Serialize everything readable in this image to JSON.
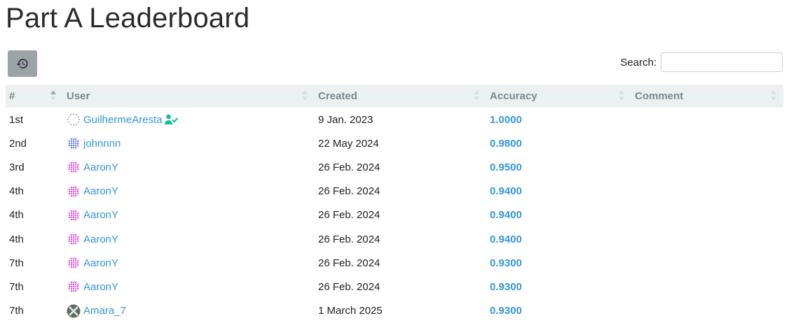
{
  "page_title": "Part A Leaderboard",
  "search": {
    "label": "Search:",
    "value": "",
    "placeholder": ""
  },
  "history_button": {
    "icon": "history-icon"
  },
  "table": {
    "columns": [
      "#",
      "User",
      "Created",
      "Accuracy",
      "Comment"
    ],
    "sort": {
      "column": "#",
      "direction": "asc"
    },
    "rows": [
      {
        "rank": "1st",
        "user": "GuilhermeAresta",
        "avatar": "avatar-dots-grey",
        "verified": true,
        "created": "9 Jan. 2023",
        "accuracy": "1.0000",
        "comment": ""
      },
      {
        "rank": "2nd",
        "user": "johnnnn",
        "avatar": "avatar-grid-blue",
        "verified": false,
        "created": "22 May 2024",
        "accuracy": "0.9800",
        "comment": ""
      },
      {
        "rank": "3rd",
        "user": "AaronY",
        "avatar": "avatar-grid-pink",
        "verified": false,
        "created": "26 Feb. 2024",
        "accuracy": "0.9500",
        "comment": ""
      },
      {
        "rank": "4th",
        "user": "AaronY",
        "avatar": "avatar-grid-pink",
        "verified": false,
        "created": "26 Feb. 2024",
        "accuracy": "0.9400",
        "comment": ""
      },
      {
        "rank": "4th",
        "user": "AaronY",
        "avatar": "avatar-grid-pink",
        "verified": false,
        "created": "26 Feb. 2024",
        "accuracy": "0.9400",
        "comment": ""
      },
      {
        "rank": "4th",
        "user": "AaronY",
        "avatar": "avatar-grid-pink",
        "verified": false,
        "created": "26 Feb. 2024",
        "accuracy": "0.9400",
        "comment": ""
      },
      {
        "rank": "7th",
        "user": "AaronY",
        "avatar": "avatar-grid-pink",
        "verified": false,
        "created": "26 Feb. 2024",
        "accuracy": "0.9300",
        "comment": ""
      },
      {
        "rank": "7th",
        "user": "AaronY",
        "avatar": "avatar-grid-pink",
        "verified": false,
        "created": "26 Feb. 2024",
        "accuracy": "0.9300",
        "comment": ""
      },
      {
        "rank": "7th",
        "user": "Amara_7",
        "avatar": "avatar-cross-dark",
        "verified": false,
        "created": "1 March 2025",
        "accuracy": "0.9300",
        "comment": ""
      }
    ]
  },
  "colors": {
    "link": "#3498db",
    "header_bg": "#ecf0f1",
    "header_text": "#7b8a8b",
    "verified": "#18bc9c",
    "button_bg": "#9aa3a6"
  }
}
